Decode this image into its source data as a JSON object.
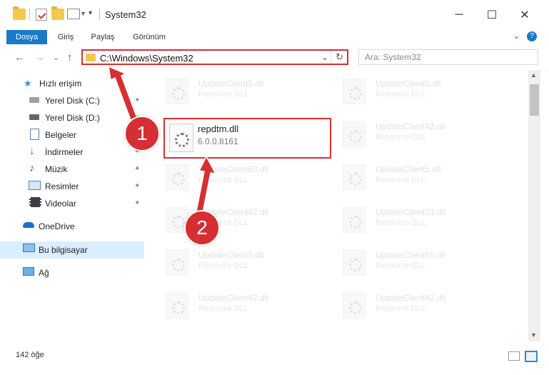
{
  "window": {
    "title": "System32",
    "minimize": "─",
    "maximize": "☐",
    "close": "✕"
  },
  "ribbon": {
    "tabs": [
      "Dosya",
      "Giriş",
      "Paylaş",
      "Görünüm"
    ],
    "expand_chevron": "⌄",
    "help": "?"
  },
  "nav": {
    "back": "←",
    "forward": "→",
    "recent": "⌄",
    "up": "↑"
  },
  "address": {
    "path": "C:\\Windows\\System32",
    "dropdown": "⌄",
    "refresh": "↻"
  },
  "search": {
    "placeholder": "Ara: System32"
  },
  "sidebar": {
    "items": [
      {
        "label": "Hızlı erişim",
        "icon": "star-icon"
      },
      {
        "label": "Yerel Disk (C:)",
        "icon": "drive-icon",
        "pinned": true
      },
      {
        "label": "Yerel Disk (D:)",
        "icon": "drive-icon",
        "pinned": true
      },
      {
        "label": "Belgeler",
        "icon": "document-icon",
        "pinned": true
      },
      {
        "label": "İndirmeler",
        "icon": "download-icon",
        "pinned": true
      },
      {
        "label": "Müzik",
        "icon": "music-icon",
        "pinned": true
      },
      {
        "label": "Resimler",
        "icon": "pictures-icon",
        "pinned": true
      },
      {
        "label": "Videolar",
        "icon": "video-icon",
        "pinned": true
      },
      {
        "label": "OneDrive",
        "icon": "cloud-icon"
      },
      {
        "label": "Bu bilgisayar",
        "icon": "computer-icon",
        "selected": true
      },
      {
        "label": "Ağ",
        "icon": "network-icon"
      }
    ],
    "pin_glyph": "📌"
  },
  "files": {
    "left": [
      {
        "name": "UpdateClient5.dll",
        "desc": "Resource DLL"
      },
      {
        "name": "UpdateClient63.dll",
        "desc": "Resource DLL"
      },
      {
        "name": "UpdateClient42.dll",
        "desc": "Resource DLL"
      },
      {
        "name": "UpdateClient5.dll",
        "desc": "Resource DLL"
      },
      {
        "name": "UpdateClient42.dll",
        "desc": "Resource DLL"
      }
    ],
    "right": [
      {
        "name": "UpdateClient5.dll",
        "desc": "Resource DLL"
      },
      {
        "name": "UpdateClient42.dll",
        "desc": "Resource DLL"
      },
      {
        "name": "UpdateClient5.dll",
        "desc": "Resource DLL"
      },
      {
        "name": "UpdateClient21.dll",
        "desc": "Resource DLL"
      },
      {
        "name": "UpdateClient65.dll",
        "desc": "Resource DLL"
      },
      {
        "name": "UpdateClient42.dll",
        "desc": "Resource DLL"
      }
    ],
    "highlighted": {
      "name": "repdtm.dll",
      "version": "6.0.0.8161"
    }
  },
  "annotations": {
    "step1": "1",
    "step2": "2",
    "color": "#d62f33"
  },
  "status": {
    "count": "142 öğe"
  }
}
